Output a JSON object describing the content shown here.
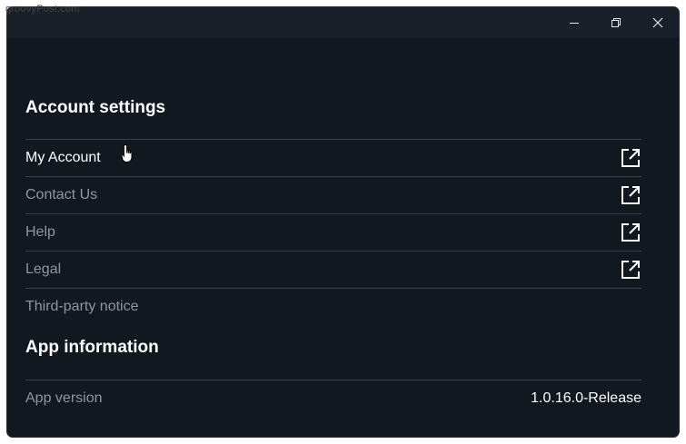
{
  "watermark": "groovyPost.com",
  "window": {
    "controls": [
      {
        "name": "minimize-button",
        "icon": "minimize-icon"
      },
      {
        "name": "restore-button",
        "icon": "restore-icon"
      },
      {
        "name": "close-button",
        "icon": "close-icon"
      }
    ]
  },
  "account_settings": {
    "title": "Account settings",
    "items": [
      {
        "label": "My Account",
        "external": true,
        "active": true
      },
      {
        "label": "Contact Us",
        "external": true
      },
      {
        "label": "Help",
        "external": true
      },
      {
        "label": "Legal",
        "external": true
      },
      {
        "label": "Third-party notice",
        "external": false
      }
    ]
  },
  "app_information": {
    "title": "App information",
    "version_label": "App version",
    "version_value": "1.0.16.0-Release"
  },
  "colors": {
    "background": "#111820",
    "titlebar": "#1a2029",
    "divider": "#3a4049",
    "text_primary": "#ffffff",
    "text_secondary": "#8d96a3"
  }
}
